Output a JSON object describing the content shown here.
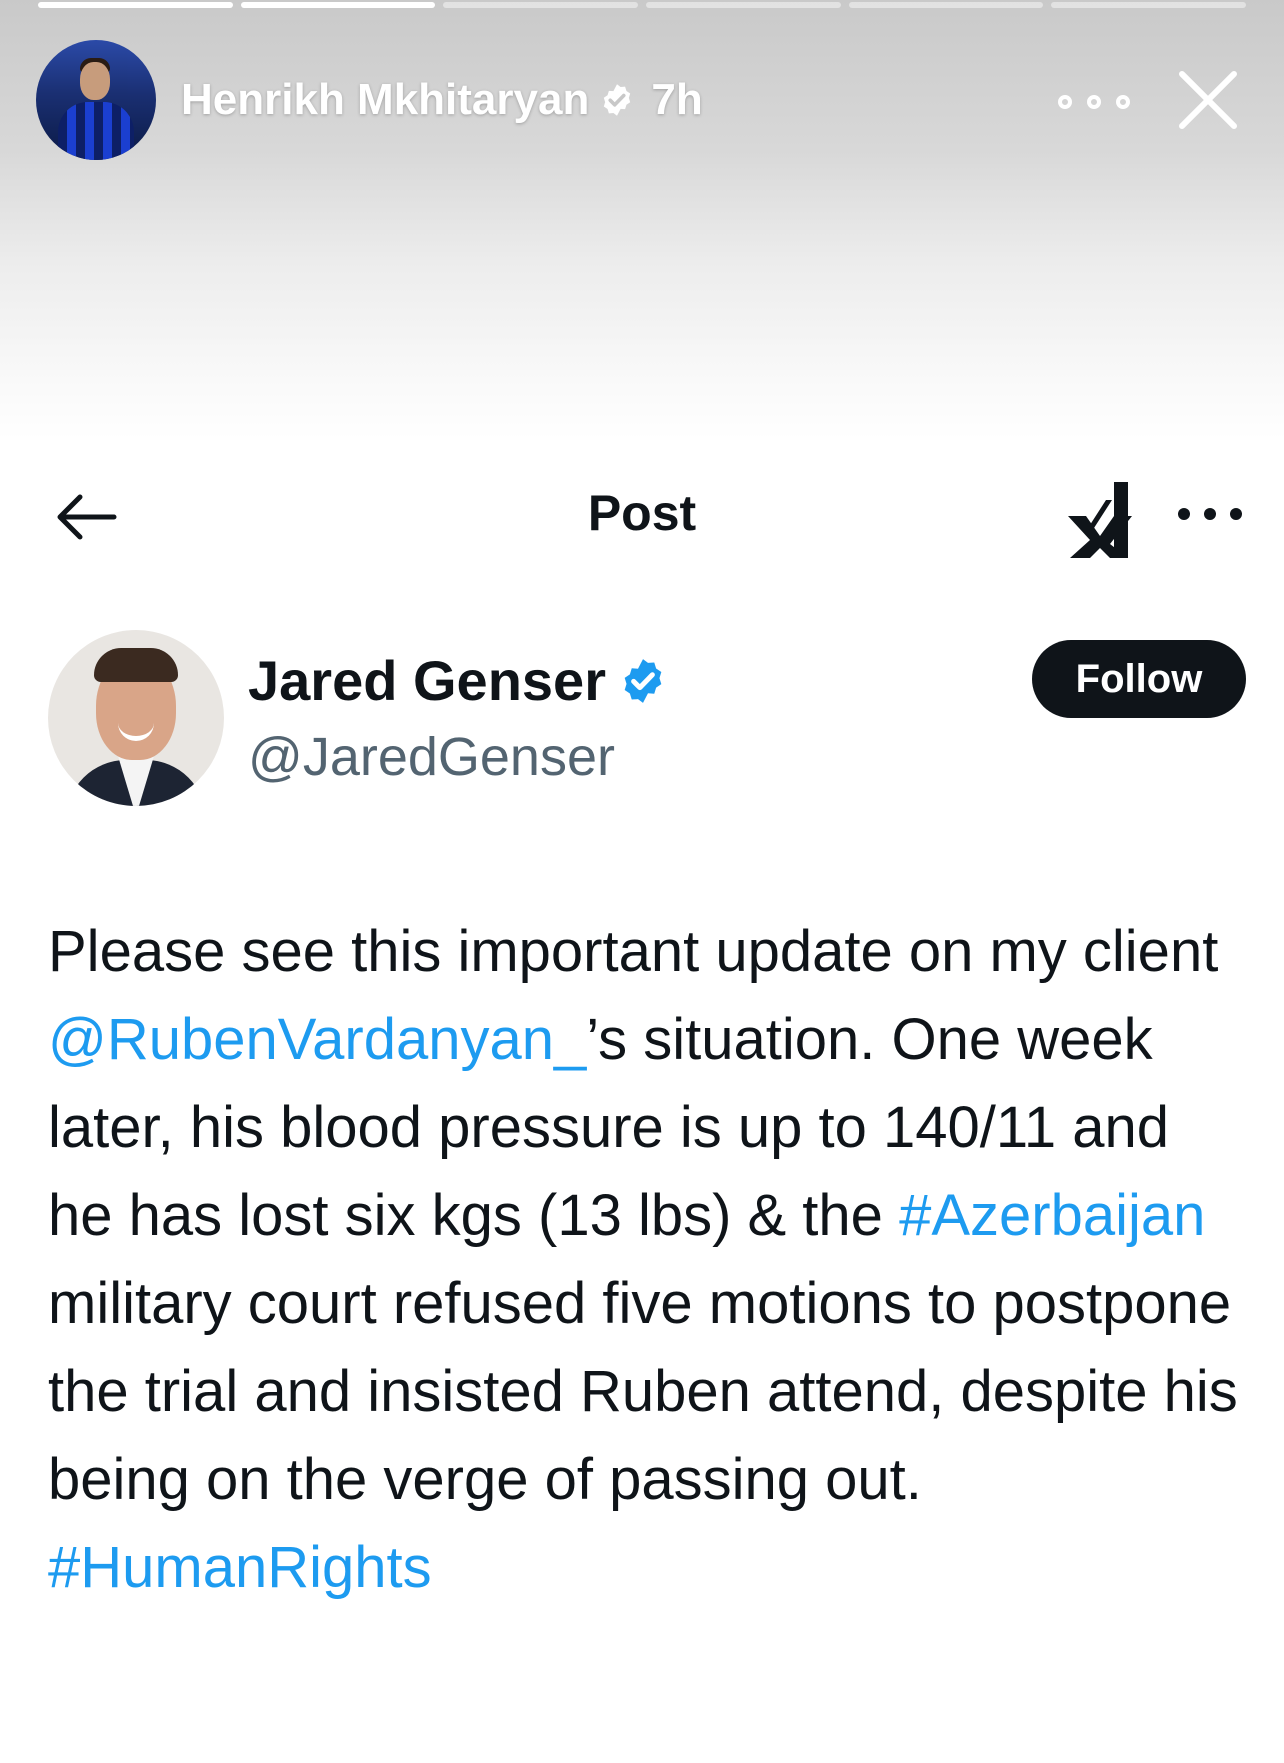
{
  "story": {
    "progress": [
      1,
      1,
      0,
      0,
      0,
      0
    ],
    "username": "Henrikh Mkhitaryan",
    "time": "7h",
    "more_icon": "ellipsis-circles-icon",
    "close_icon": "close-icon"
  },
  "post": {
    "title": "Post",
    "author_name": "Jared Genser",
    "author_handle": "@JaredGenser",
    "follow_label": "Follow",
    "text": [
      {
        "t": "Please see this important update on my client ",
        "link": false
      },
      {
        "t": "@RubenVardanyan_",
        "link": true
      },
      {
        "t": "’s situation. One week later, his blood pressure is up to 140/11 and he has lost six kgs (13 lbs) & the ",
        "link": false
      },
      {
        "t": "#Azerbaijan",
        "link": true
      },
      {
        "t": " military court refused five motions to postpone the trial and insisted Ruben attend, despite his being on the verge of passing out. ",
        "link": false
      },
      {
        "t": "#HumanRights",
        "link": true
      }
    ],
    "link_color": "#1d9bf0",
    "verified_color": "#1d9bf0"
  }
}
